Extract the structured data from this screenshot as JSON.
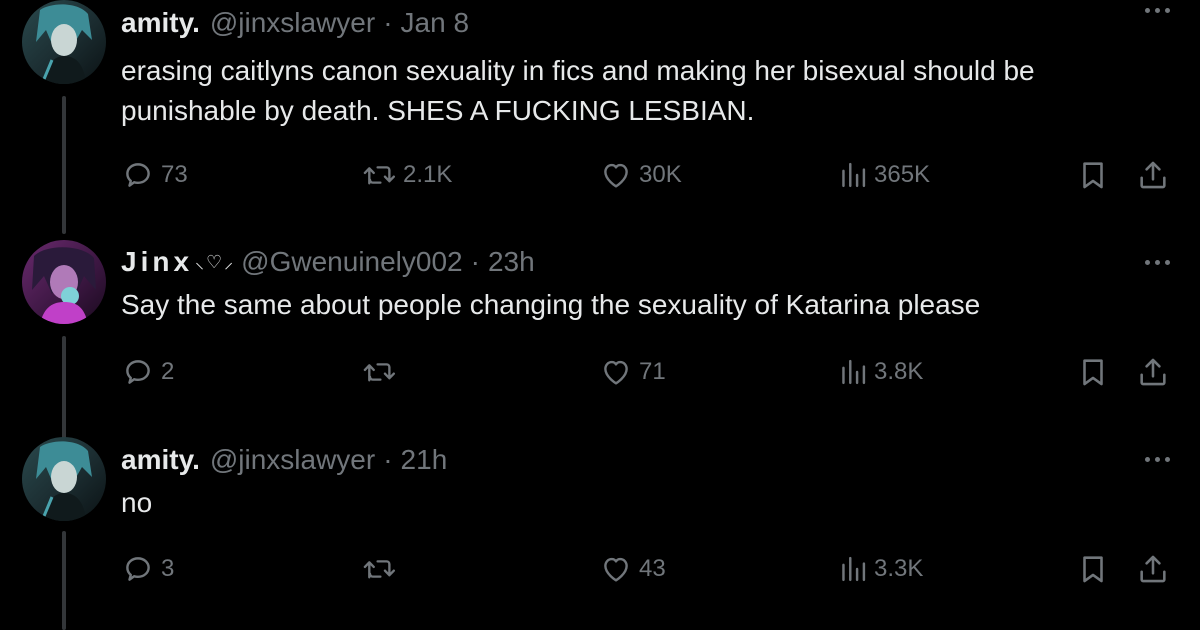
{
  "tweets": [
    {
      "name": "amity.",
      "name_decoration": "",
      "handle": "@jinxslawyer",
      "separator": "·",
      "time": "Jan 8",
      "text": "erasing caitlyns canon sexuality in fics and making her bisexual should be punishable by death. SHES A FUCKING LESBIAN.",
      "replies": "73",
      "reposts": "2.1K",
      "likes": "30K",
      "views": "365K"
    },
    {
      "name": "Jinx",
      "name_decoration": "⸜♡⸝",
      "handle": "@Gwenuinely002",
      "separator": "·",
      "time": "23h",
      "text": "Say the same about people changing the sexuality of Katarina please",
      "replies": "2",
      "reposts": "",
      "likes": "71",
      "views": "3.8K"
    },
    {
      "name": "amity.",
      "name_decoration": "",
      "handle": "@jinxslawyer",
      "separator": "·",
      "time": "21h",
      "text": "no",
      "replies": "3",
      "reposts": "",
      "likes": "43",
      "views": "3.3K"
    }
  ],
  "icons": {
    "reply": "reply-icon",
    "repost": "repost-icon",
    "like": "heart-icon",
    "views": "views-icon",
    "bookmark": "bookmark-icon",
    "share": "share-icon",
    "more": "more-icon"
  },
  "colors": {
    "background": "#000000",
    "text": "#e7e9ea",
    "muted": "#71767b",
    "thread_line": "#333639"
  }
}
